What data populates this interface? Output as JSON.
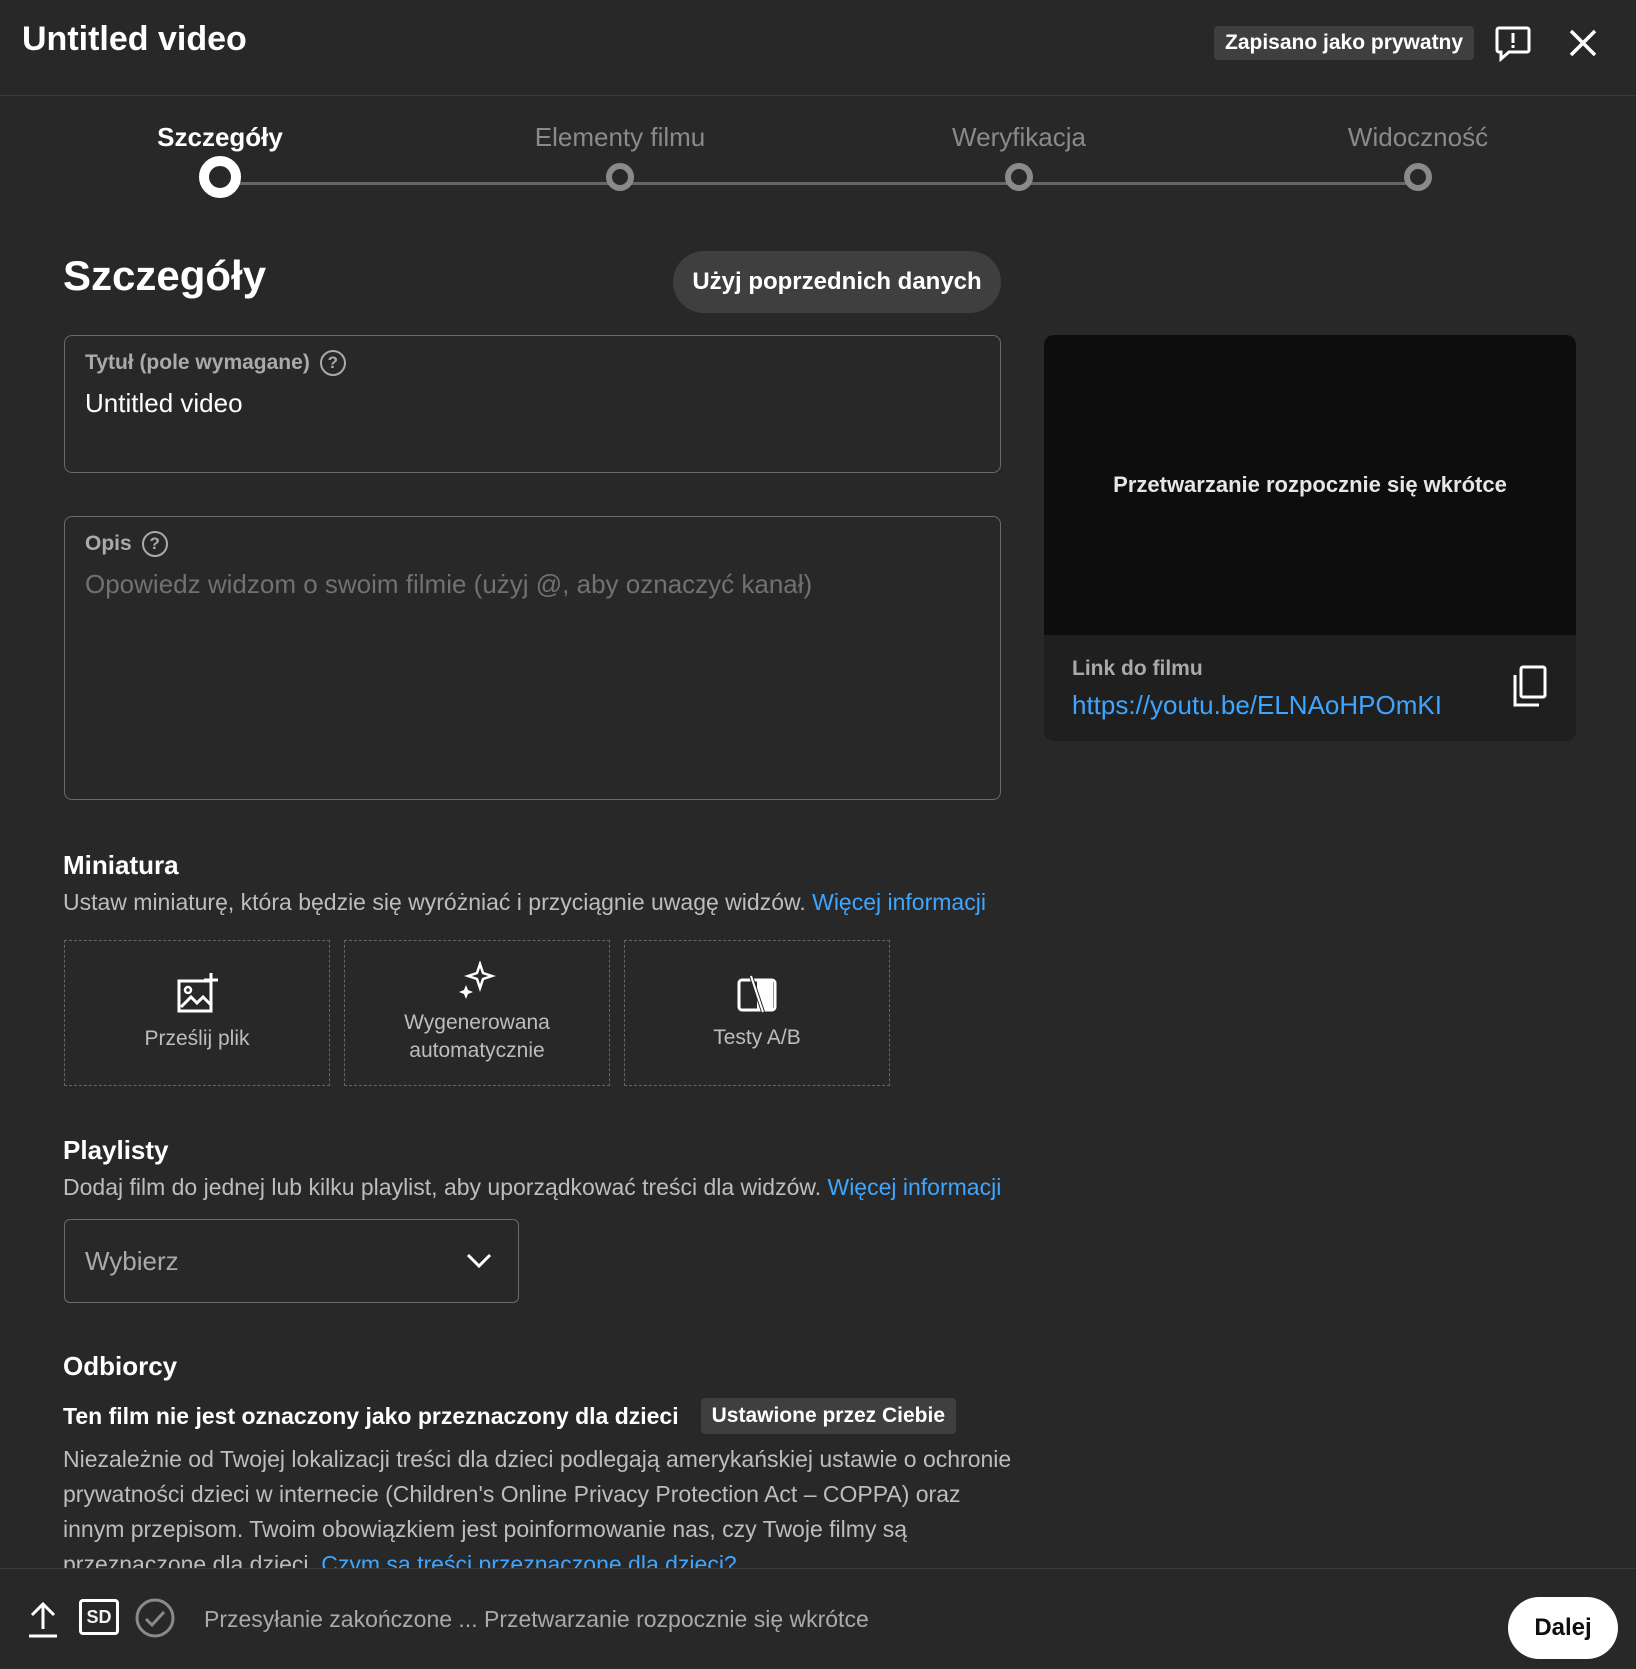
{
  "header": {
    "title": "Untitled video",
    "saved_badge": "Zapisano jako prywatny",
    "feedback_icon": "feedback-icon",
    "close_icon": "close-icon"
  },
  "steps": [
    {
      "label": "Szczegóły",
      "active": true
    },
    {
      "label": "Elementy filmu",
      "active": false
    },
    {
      "label": "Weryfikacja",
      "active": false
    },
    {
      "label": "Widoczność",
      "active": false
    }
  ],
  "details": {
    "heading": "Szczegóły",
    "reuse_button": "Użyj poprzednich danych",
    "title_field": {
      "label": "Tytuł (pole wymagane)",
      "value": "Untitled video"
    },
    "description_field": {
      "label": "Opis",
      "placeholder": "Opowiedz widzom o swoim filmie (użyj @, aby oznaczyć kanał)"
    }
  },
  "preview": {
    "processing_text": "Przetwarzanie rozpocznie się wkrótce",
    "link_label": "Link do filmu",
    "link_url": "https://youtu.be/ELNAoHPOmKI"
  },
  "thumbnail": {
    "heading": "Miniatura",
    "description": "Ustaw miniaturę, która będzie się wyróżniać i przyciągnie uwagę widzów.",
    "more_link": "Więcej informacji",
    "options": [
      {
        "label": "Prześlij plik",
        "icon": "image-add-icon"
      },
      {
        "label": "Wygenerowana automatycznie",
        "icon": "sparkle-icon"
      },
      {
        "label": "Testy A/B",
        "icon": "ab-test-icon"
      }
    ]
  },
  "playlists": {
    "heading": "Playlisty",
    "description": "Dodaj film do jednej lub kilku playlist, aby uporządkować treści dla widzów.",
    "more_link": "Więcej informacji",
    "select_value": "Wybierz"
  },
  "audience": {
    "heading": "Odbiorcy",
    "status": "Ten film nie jest oznaczony jako przeznaczony dla dzieci",
    "tag": "Ustawione przez Ciebie",
    "paragraph": "Niezależnie od Twojej lokalizacji treści dla dzieci podlegają amerykańskiej ustawie o ochronie prywatności dzieci w internecie (Children's Online Privacy Protection Act – COPPA) oraz innym przepisom. Twoim obowiązkiem jest poinformowanie nas, czy Twoje filmy są przeznaczone dla dzieci.",
    "link": "Czym są treści przeznaczone dla dzieci?"
  },
  "footer": {
    "status": "Przesyłanie zakończone ... Przetwarzanie rozpocznie się wkrótce",
    "sd_label": "SD",
    "next_button": "Dalej"
  }
}
